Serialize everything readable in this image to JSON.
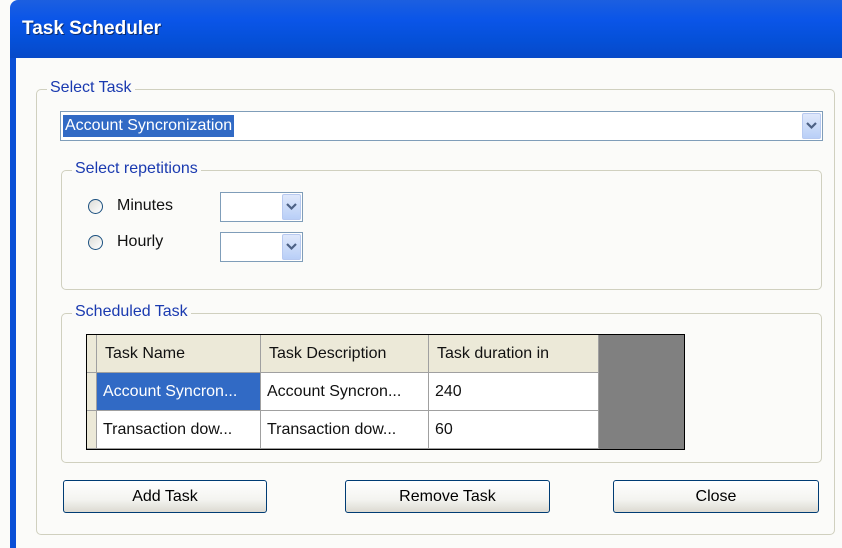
{
  "window": {
    "title": "Task Scheduler"
  },
  "select_task": {
    "legend": "Select Task",
    "selected_value": "Account Syncronization"
  },
  "repetitions": {
    "legend": "Select repetitions",
    "options": [
      {
        "label": "Minutes",
        "selected": false,
        "value": ""
      },
      {
        "label": "Hourly",
        "selected": false,
        "value": ""
      }
    ]
  },
  "scheduled": {
    "legend": "Scheduled Task",
    "columns": [
      "Task Name",
      "Task Description",
      "Task duration in"
    ],
    "rows": [
      {
        "name": "Account Syncron...",
        "description": "Account Syncron...",
        "duration": "240",
        "selected": true
      },
      {
        "name": "Transaction dow...",
        "description": "Transaction dow...",
        "duration": "60",
        "selected": false
      }
    ]
  },
  "buttons": {
    "add": "Add Task",
    "remove": "Remove Task",
    "close": "Close"
  },
  "colors": {
    "title_bar": "#0550d8",
    "legend_text": "#1a3ab0",
    "selection": "#316ac5",
    "grid_background": "#808080"
  },
  "icons": {
    "dropdown": "chevron-down-icon"
  }
}
